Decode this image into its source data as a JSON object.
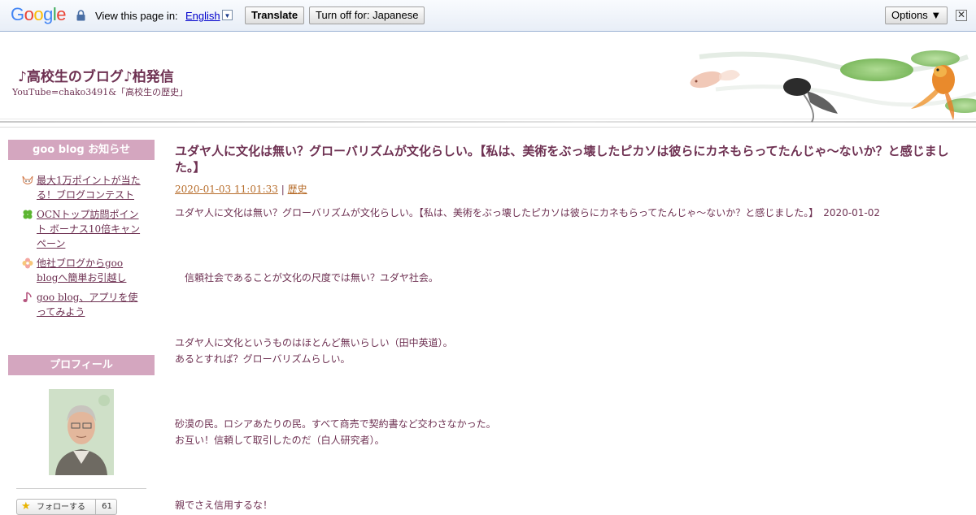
{
  "translate_bar": {
    "view_text": "View this page in:",
    "language": "English",
    "translate_button": "Translate",
    "turn_off_button": "Turn off for: Japanese",
    "options_button": "Options ▼",
    "close_glyph": "✕"
  },
  "blog": {
    "title": "♪高校生のブログ♪柏発信",
    "subtitle": "YouTube=chako3491&「高校生の歴史」"
  },
  "sidebar": {
    "notice_heading": "goo blog お知らせ",
    "notices": [
      {
        "label": "最大1万ポイントが当たる！ブログコンテスト",
        "icon": "fox-icon"
      },
      {
        "label": "OCNトップ訪問ポイント ボーナス10倍キャンペーン",
        "icon": "clover-icon"
      },
      {
        "label": "他社ブログからgoo blogへ簡単お引越し",
        "icon": "flower-icon"
      },
      {
        "label": "goo blog、アプリを使ってみよう",
        "icon": "music-note-icon"
      }
    ],
    "profile_heading": "プロフィール",
    "follow_label": "フォローする",
    "follow_count": "61"
  },
  "post": {
    "title": "ユダヤ人に文化は無い？グローバリズムが文化らしい。【私は、美術をぶっ壊したピカソは彼らにカネもらってたんじゃ〜ないか？と感じました。】",
    "datetime": "2020-01-03 11:01:33",
    "separator": "|",
    "category": "歴史",
    "line1": "ユダヤ人に文化は無い？グローバリズムが文化らしい。【私は、美術をぶっ壊したピカソは彼らにカネもらってたんじゃ〜ないか？と感じました。】　2020-01-02",
    "line2": "　信頼社会であることが文化の尺度では無い？ユダヤ社会。",
    "line3": "ユダヤ人に文化というものはほとんど無いらしい（田中英道）。",
    "line4": "あるとすれば？グローバリズムらしい。",
    "line5": "砂漠の民。ロシアあたりの民。すべて商売で契約書など交わさなかった。",
    "line6": "お互い！信頼して取引したのだ（白人研究者）。",
    "line7": "親でさえ信用するな！"
  },
  "colors": {
    "accent": "#6e3152",
    "sidebar_heading_bg": "#d4a6bf",
    "meta_link": "#b76d2b"
  }
}
